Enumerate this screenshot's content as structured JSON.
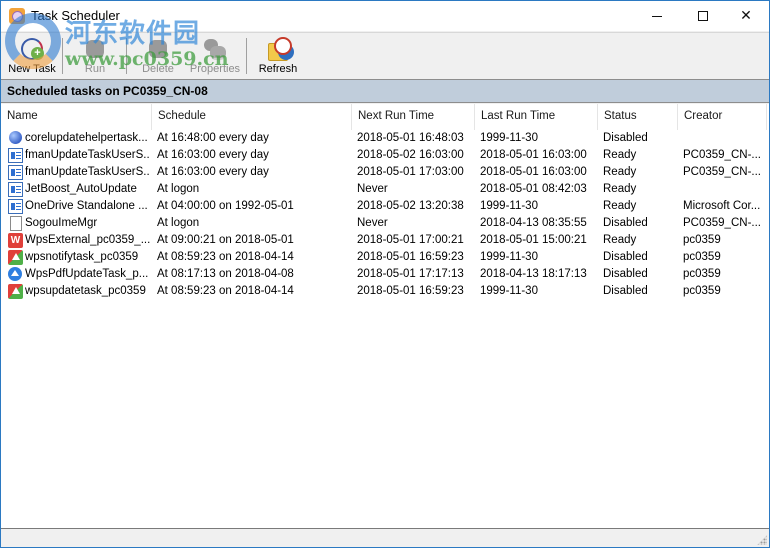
{
  "window": {
    "title": "Task Scheduler",
    "controls": {
      "minimize": "minimize",
      "maximize": "maximize",
      "close": "close"
    }
  },
  "toolbar": {
    "buttons": [
      {
        "label": "New Task",
        "icon": "new-task-icon",
        "enabled": true
      },
      {
        "label": "Run",
        "icon": "run-icon",
        "enabled": false
      },
      {
        "label": "Delete",
        "icon": "delete-icon",
        "enabled": false
      },
      {
        "label": "Properties",
        "icon": "properties-icon",
        "enabled": false
      },
      {
        "label": "Refresh",
        "icon": "refresh-icon",
        "enabled": true
      }
    ]
  },
  "panel": {
    "title": "Scheduled tasks on PC0359_CN-08"
  },
  "table": {
    "columns": [
      "Name",
      "Schedule",
      "Next Run Time",
      "Last Run Time",
      "Status",
      "Creator"
    ],
    "rows": [
      {
        "icon": "globe",
        "name": "corelupdatehelpertask...",
        "schedule": "At 16:48:00 every day",
        "next": "2018-05-01 16:48:03",
        "last": "1999-11-30",
        "status": "Disabled",
        "creator": ""
      },
      {
        "icon": "window",
        "name": "fmanUpdateTaskUserS...",
        "schedule": "At 16:03:00 every day",
        "next": "2018-05-02 16:03:00",
        "last": "2018-05-01 16:03:00",
        "status": "Ready",
        "creator": "PC0359_CN-..."
      },
      {
        "icon": "window",
        "name": "fmanUpdateTaskUserS...",
        "schedule": "At 16:03:00 every day",
        "next": "2018-05-01 17:03:00",
        "last": "2018-05-01 16:03:00",
        "status": "Ready",
        "creator": "PC0359_CN-..."
      },
      {
        "icon": "window",
        "name": "JetBoost_AutoUpdate",
        "schedule": "At logon",
        "next": "Never",
        "last": "2018-05-01 08:42:03",
        "status": "Ready",
        "creator": ""
      },
      {
        "icon": "window",
        "name": "OneDrive Standalone ...",
        "schedule": "At 04:00:00 on 1992-05-01",
        "next": "2018-05-02 13:20:38",
        "last": "1999-11-30",
        "status": "Ready",
        "creator": "Microsoft Cor..."
      },
      {
        "icon": "file",
        "name": "SogouImeMgr",
        "schedule": "At logon",
        "next": "Never",
        "last": "2018-04-13 08:35:55",
        "status": "Disabled",
        "creator": "PC0359_CN-..."
      },
      {
        "icon": "wps",
        "name": "WpsExternal_pc0359_...",
        "schedule": "At 09:00:21 on 2018-05-01",
        "next": "2018-05-01 17:00:21",
        "last": "2018-05-01 15:00:21",
        "status": "Ready",
        "creator": "pc0359"
      },
      {
        "icon": "upd",
        "name": "wpsnotifytask_pc0359",
        "schedule": "At 08:59:23 on 2018-04-14",
        "next": "2018-05-01 16:59:23",
        "last": "1999-11-30",
        "status": "Disabled",
        "creator": "pc0359"
      },
      {
        "icon": "pdf",
        "name": "WpsPdfUpdateTask_p...",
        "schedule": "At 08:17:13 on 2018-04-08",
        "next": "2018-05-01 17:17:13",
        "last": "2018-04-13 18:17:13",
        "status": "Disabled",
        "creator": "pc0359"
      },
      {
        "icon": "upd",
        "name": "wpsupdatetask_pc0359",
        "schedule": "At 08:59:23 on 2018-04-14",
        "next": "2018-05-01 16:59:23",
        "last": "1999-11-30",
        "status": "Disabled",
        "creator": "pc0359"
      }
    ]
  },
  "watermark": {
    "cn": "河东软件园",
    "url": "www.pc0359.cn"
  },
  "colors": {
    "panel_header": "#c0cddb",
    "window_border": "#2b79c2",
    "disabled_text": "#8d8d8d"
  }
}
